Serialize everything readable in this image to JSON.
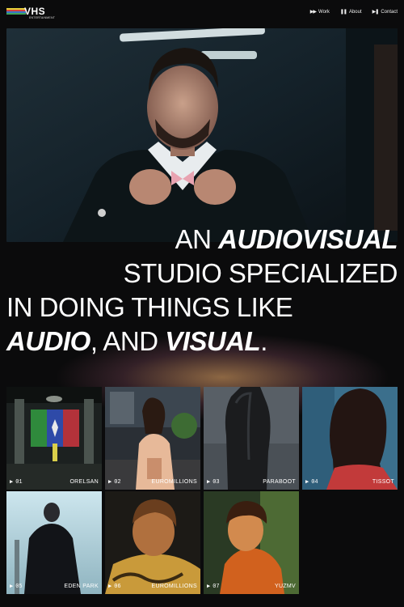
{
  "brand": {
    "name": "VHS",
    "tagline": "ENTERTAINMENT",
    "stripe_colors": [
      "#e6d23a",
      "#d9453a",
      "#3b74c9",
      "#3fa35b"
    ]
  },
  "nav": {
    "items": [
      {
        "icon": "fast-forward-icon",
        "glyph": "▶▶",
        "label": "Work"
      },
      {
        "icon": "pause-icon",
        "glyph": "❚❚",
        "label": "About"
      },
      {
        "icon": "skip-icon",
        "glyph": "▶❚",
        "label": "Contact"
      }
    ]
  },
  "headline": {
    "line1_a": "AN ",
    "line1_b": "AUDIOVISUAL",
    "line2": "STUDIO SPECIALIZED",
    "line3": "IN DOING THINGS LIKE",
    "line4_a": "AUDIO",
    "line4_b": ", AND ",
    "line4_c": "VISUAL",
    "line4_d": "."
  },
  "projects": [
    {
      "num": "01",
      "client": "ORELSAN"
    },
    {
      "num": "02",
      "client": "EUROMILLIONS"
    },
    {
      "num": "03",
      "client": "PARABOOT"
    },
    {
      "num": "04",
      "client": "TISSOT"
    },
    {
      "num": "05",
      "client": "EDEN PARK"
    },
    {
      "num": "06",
      "client": "EUROMILLIONS"
    },
    {
      "num": "07",
      "client": "YUZMV"
    }
  ],
  "play_glyph": "▶"
}
